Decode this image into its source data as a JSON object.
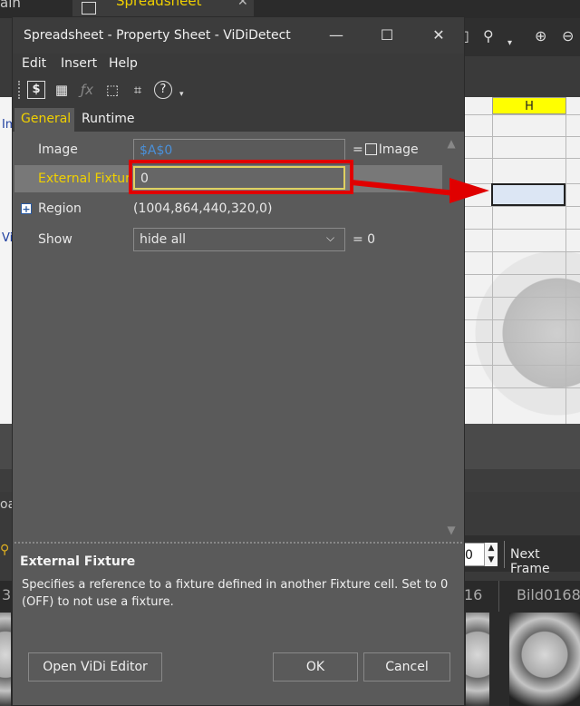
{
  "background": {
    "tab_main": "ain",
    "tab_spreadsheet": "Spreadsheet",
    "column_h": "H",
    "left_labels": [
      "Im",
      "Vi"
    ],
    "bottom_left_label": "oa",
    "frame_value": "0",
    "next_frame": "Next Frame",
    "film_labels": [
      "3",
      "16",
      "Bild0168"
    ]
  },
  "dialog": {
    "title": "Spreadsheet - Property Sheet - ViDiDetect",
    "window_minimize": "—",
    "window_maximize": "☐",
    "window_close": "✕",
    "menu": [
      "Edit",
      "Insert",
      "Help"
    ],
    "tabs": [
      {
        "label": "General",
        "active": true
      },
      {
        "label": "Runtime",
        "active": false
      }
    ],
    "properties": [
      {
        "label": "Image",
        "value": "$A$0",
        "suffix": "Image"
      },
      {
        "label": "External Fixture",
        "value": "0"
      },
      {
        "label": "Region",
        "value": "(1004,864,440,320,0)"
      },
      {
        "label": "Show",
        "value": "hide all",
        "suffix": "= 0"
      }
    ],
    "description_title": "External Fixture",
    "description_text": "Specifies a reference to a fixture defined in another Fixture cell. Set to 0 (OFF) to not use a fixture.",
    "buttons": {
      "open_vidi": "Open ViDi Editor",
      "ok": "OK",
      "cancel": "Cancel"
    }
  },
  "colors": {
    "accent_yellow": "#f0d000",
    "annotation_red": "#e00000",
    "link_blue": "#4a90d9"
  }
}
